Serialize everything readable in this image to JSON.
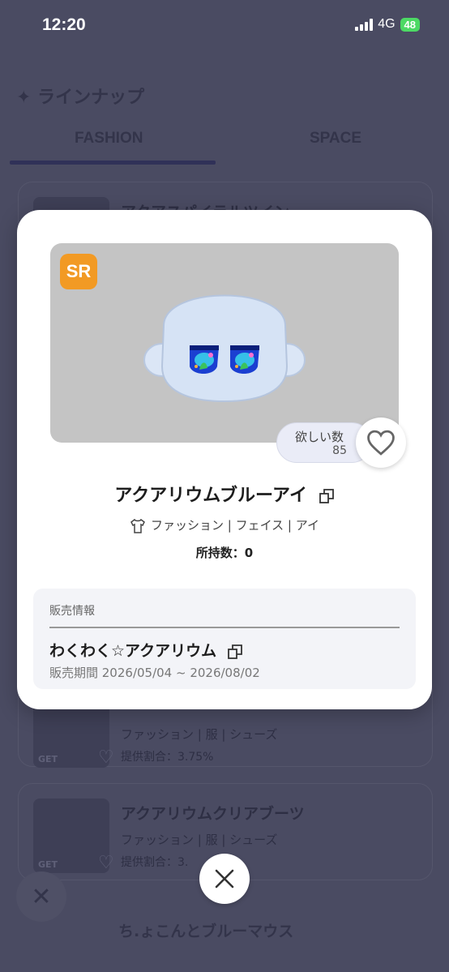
{
  "status": {
    "time": "12:20",
    "network": "4G",
    "battery": "48"
  },
  "background": {
    "section_title": "ラインナップ",
    "tabs": [
      {
        "label": "FASHION"
      },
      {
        "label": "SPACE"
      }
    ],
    "cards": [
      {
        "name": "アクアスパイラルツイン",
        "category": "",
        "rate": ""
      },
      {
        "name": "",
        "category": "ファッション | 服 | シューズ",
        "rate": "提供割合：3.75%",
        "get": "GET"
      },
      {
        "name": "アクアリウムクリアブーツ",
        "category": "ファッション | 服 | シューズ",
        "rate": "提供割合：3.",
        "get": "GET"
      }
    ],
    "bottom_item": "ち.ょこんとブルーマウス"
  },
  "modal": {
    "rarity": "SR",
    "want_label": "欲しい数",
    "want_count": "85",
    "title": "アクアリウムブルーアイ",
    "category": "ファッション | フェイス | アイ",
    "owned": "所持数：0",
    "sale": {
      "header": "販売情報",
      "event_name": "わくわく☆アクアリウム",
      "period": "販売期間 2026/05/04 ~ 2026/08/02"
    }
  },
  "icons": [
    "sparkle-icon",
    "heart-icon",
    "copy-icon",
    "shirt-icon",
    "close-icon"
  ],
  "colors": {
    "rarity_bg": "#f29a24",
    "dim_bg": "#4a4b62",
    "battery": "#4cd964"
  }
}
